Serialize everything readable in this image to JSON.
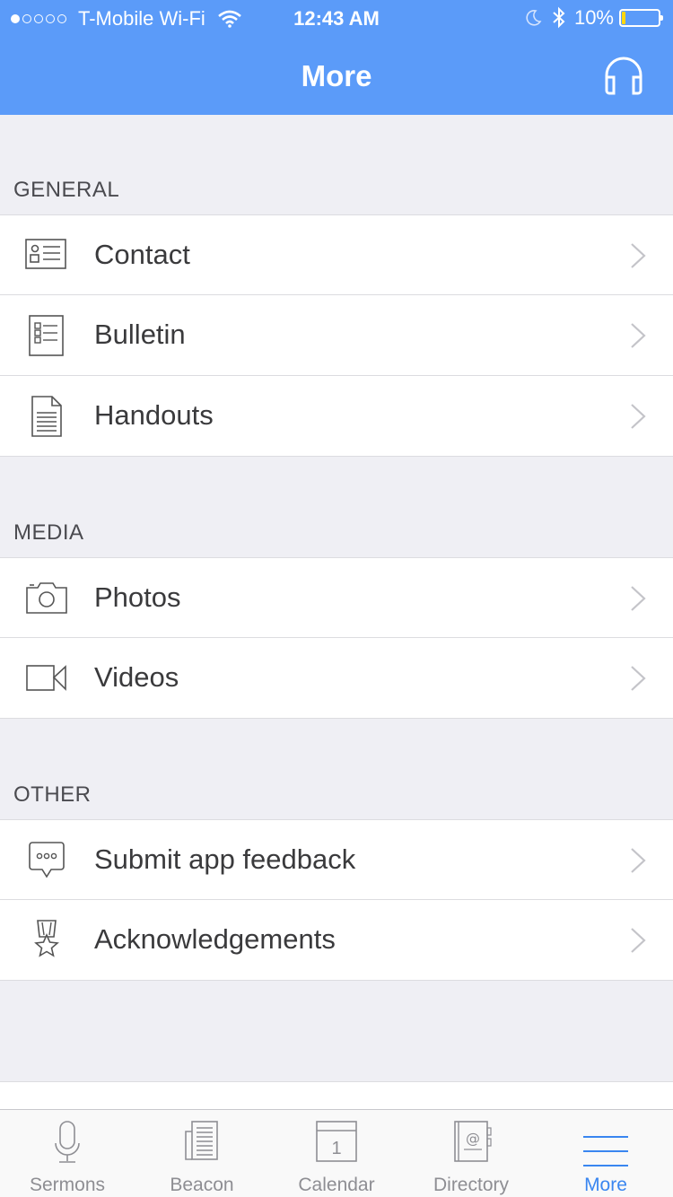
{
  "status_bar": {
    "carrier": "T-Mobile Wi-Fi",
    "time": "12:43 AM",
    "battery_percent": "10%",
    "battery_level": 0.1
  },
  "nav": {
    "title": "More",
    "action_icon": "headphones-icon"
  },
  "sections": {
    "general": {
      "header": "GENERAL",
      "items": [
        {
          "label": "Contact",
          "icon": "contact-card-icon"
        },
        {
          "label": "Bulletin",
          "icon": "bulletin-icon"
        },
        {
          "label": "Handouts",
          "icon": "document-icon"
        }
      ]
    },
    "media": {
      "header": "MEDIA",
      "items": [
        {
          "label": "Photos",
          "icon": "camera-icon"
        },
        {
          "label": "Videos",
          "icon": "video-camera-icon"
        }
      ]
    },
    "other": {
      "header": "OTHER",
      "items": [
        {
          "label": "Submit app feedback",
          "icon": "chat-bubble-icon"
        },
        {
          "label": "Acknowledgements",
          "icon": "award-icon"
        }
      ]
    }
  },
  "tab_bar": {
    "tabs": [
      {
        "label": "Sermons",
        "icon": "microphone-icon"
      },
      {
        "label": "Beacon",
        "icon": "newspaper-icon"
      },
      {
        "label": "Calendar",
        "icon": "calendar-icon",
        "day": "1"
      },
      {
        "label": "Directory",
        "icon": "address-book-icon"
      },
      {
        "label": "More",
        "icon": "menu-lines-icon",
        "active": true
      }
    ]
  },
  "colors": {
    "header_blue": "#5b9bf9",
    "active_tab": "#3a86f0",
    "inactive_tab": "#8e8e93",
    "background": "#efeff4"
  }
}
